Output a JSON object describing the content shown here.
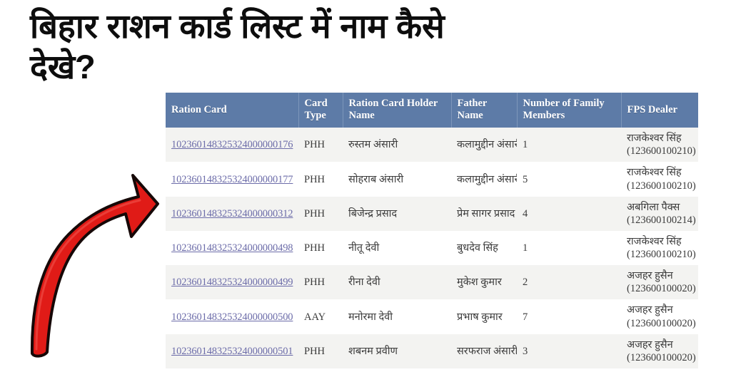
{
  "heading": {
    "line1": "बिहार राशन कार्ड लिस्ट में नाम कैसे",
    "line2": "देखे?"
  },
  "annotation": {
    "arrow_name": "red-curved-arrow",
    "color": "#e01b17",
    "outline_color": "#1a0a08",
    "direction": "up-right"
  },
  "colors": {
    "header_bg": "#5d7ba7",
    "header_text": "#ffffff",
    "row_odd_bg": "#f3f3f1",
    "row_even_bg": "#ffffff",
    "link": "#6c6ca9",
    "body_text": "#3b3b3b"
  },
  "table": {
    "columns": [
      "Ration Card",
      "Card Type",
      "Ration Card Holder Name",
      "Father Name",
      "Number of Family Members",
      "FPS Dealer"
    ],
    "rows": [
      {
        "ration_card": "1023601483253240000001 76",
        "card_number": "102360148325324000000176",
        "card_type": "PHH",
        "holder_name": "रुस्तम अंसारी",
        "father_name": "कलामुद्दीन अंसारी",
        "family_members": "1",
        "fps_dealer_name": "राजकेश्वर सिंह",
        "fps_dealer_code": "(123600100210)"
      },
      {
        "card_number": "102360148325324000000177",
        "card_type": "PHH",
        "holder_name": "सोहराब अंसारी",
        "father_name": "कलामुद्दीन अंसारी",
        "family_members": "5",
        "fps_dealer_name": "राजकेश्वर सिंह",
        "fps_dealer_code": "(123600100210)"
      },
      {
        "card_number": "102360148325324000000312",
        "card_type": "PHH",
        "holder_name": "बिजेन्द्र प्रसाद",
        "father_name": "प्रेम सागर प्रसाद",
        "family_members": "4",
        "fps_dealer_name": "अबगिला पैक्स",
        "fps_dealer_code": "(123600100214)"
      },
      {
        "card_number": "102360148325324000000498",
        "card_type": "PHH",
        "holder_name": "नीतू देवी",
        "father_name": "बुधदेव सिंह",
        "family_members": "1",
        "fps_dealer_name": "राजकेश्वर सिंह",
        "fps_dealer_code": "(123600100210)"
      },
      {
        "card_number": "102360148325324000000499",
        "card_type": "PHH",
        "holder_name": "रीना देवी",
        "father_name": "मुकेश कुमार",
        "family_members": "2",
        "fps_dealer_name": "अजहर हुसैन",
        "fps_dealer_code": "(123600100020)"
      },
      {
        "card_number": "102360148325324000000500",
        "card_type": "AAY",
        "holder_name": "मनोरमा देवी",
        "father_name": "प्रभाष कुमार",
        "family_members": "7",
        "fps_dealer_name": "अजहर हुसैन",
        "fps_dealer_code": "(123600100020)"
      },
      {
        "card_number": "102360148325324000000501",
        "card_type": "PHH",
        "holder_name": "शबनम प्रवीण",
        "father_name": "सरफराज अंसारी",
        "family_members": "3",
        "fps_dealer_name": "अजहर हुसैन",
        "fps_dealer_code": "(123600100020)"
      }
    ]
  }
}
